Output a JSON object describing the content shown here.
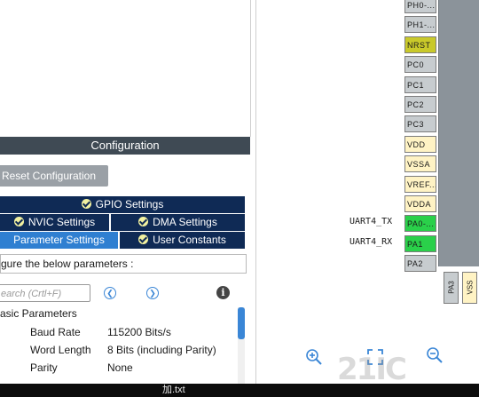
{
  "config": {
    "header": "Configuration",
    "reset_button": "Reset Configuration",
    "tabs": {
      "gpio": "GPIO Settings",
      "nvic": "NVIC Settings",
      "dma": "DMA Settings",
      "parameter": "Parameter Settings",
      "user": "User Constants"
    },
    "configure_text": "gure the below parameters :",
    "search_placeholder": "earch (Crtl+F)",
    "info_icon": "i",
    "basic_params_title": "asic Parameters",
    "params": [
      {
        "name": "Baud Rate",
        "value": "115200 Bits/s"
      },
      {
        "name": "Word Length",
        "value": "8 Bits (including Parity)"
      },
      {
        "name": "Parity",
        "value": "None"
      }
    ]
  },
  "pinout": {
    "pins": [
      {
        "label": "PH0-...",
        "color": "gray"
      },
      {
        "label": "PH1-...",
        "color": "gray"
      },
      {
        "label": "NRST",
        "color": "olive"
      },
      {
        "label": "PC0",
        "color": "gray"
      },
      {
        "label": "PC1",
        "color": "gray"
      },
      {
        "label": "PC2",
        "color": "gray"
      },
      {
        "label": "PC3",
        "color": "gray"
      },
      {
        "label": "VDD",
        "color": "yellow"
      },
      {
        "label": "VSSA",
        "color": "yellow"
      },
      {
        "label": "VREF...",
        "color": "yellow"
      },
      {
        "label": "VDDA",
        "color": "yellow"
      },
      {
        "label": "PA0-...",
        "color": "green"
      },
      {
        "label": "PA1",
        "color": "green"
      },
      {
        "label": "PA2",
        "color": "gray"
      }
    ],
    "signal_labels": {
      "tx": "UART4_TX",
      "rx": "UART4_RX"
    },
    "bottom_pins": [
      "PA3",
      "VSS"
    ]
  },
  "taskbar": {
    "file": "加.txt"
  },
  "watermark": "21IC"
}
